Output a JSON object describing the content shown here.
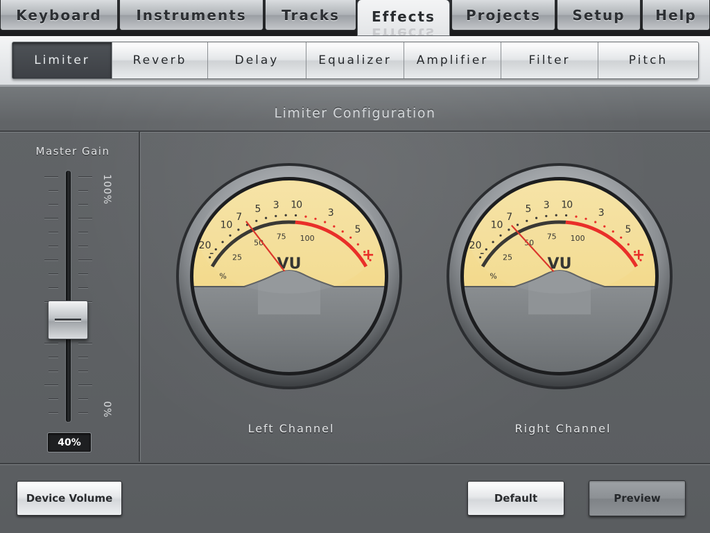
{
  "main_tabs": [
    {
      "label": "Keyboard",
      "active": false
    },
    {
      "label": "Instruments",
      "active": false
    },
    {
      "label": "Tracks",
      "active": false
    },
    {
      "label": "Effects",
      "active": true
    },
    {
      "label": "Projects",
      "active": false
    },
    {
      "label": "Setup",
      "active": false
    },
    {
      "label": "Help",
      "active": false
    }
  ],
  "sub_tabs": [
    {
      "label": "Limiter",
      "active": true
    },
    {
      "label": "Reverb",
      "active": false
    },
    {
      "label": "Delay",
      "active": false
    },
    {
      "label": "Equalizer",
      "active": false
    },
    {
      "label": "Amplifier",
      "active": false
    },
    {
      "label": "Filter",
      "active": false
    },
    {
      "label": "Pitch",
      "active": false
    }
  ],
  "panel": {
    "title": "Limiter Configuration"
  },
  "master_gain": {
    "label": "Master Gain",
    "max_label": "100%",
    "min_label": "0%",
    "value": 0.4,
    "value_text": "40%"
  },
  "meters": [
    {
      "name": "Left Channel",
      "needle_value_db": -11,
      "vu_label": "VU",
      "db_scale": [
        "20",
        "10",
        "7",
        "5",
        "3",
        "1",
        "0",
        "3",
        "5"
      ],
      "pct_scale": [
        "%",
        "25",
        "50",
        "75",
        "100"
      ],
      "minus_sign": "-",
      "plus_sign": "+"
    },
    {
      "name": "Right Channel",
      "needle_value_db": -14,
      "vu_label": "VU",
      "db_scale": [
        "20",
        "10",
        "7",
        "5",
        "3",
        "1",
        "0",
        "3",
        "5"
      ],
      "pct_scale": [
        "%",
        "25",
        "50",
        "75",
        "100"
      ],
      "minus_sign": "-",
      "plus_sign": "+"
    }
  ],
  "buttons": {
    "device_volume": "Device Volume",
    "default": "Default",
    "preview": "Preview"
  },
  "colors": {
    "meter_face": "#f0d27a",
    "meter_red_zone": "#e8231c",
    "needle": "#d92b1f",
    "active_sub_tab": "#44484c"
  }
}
